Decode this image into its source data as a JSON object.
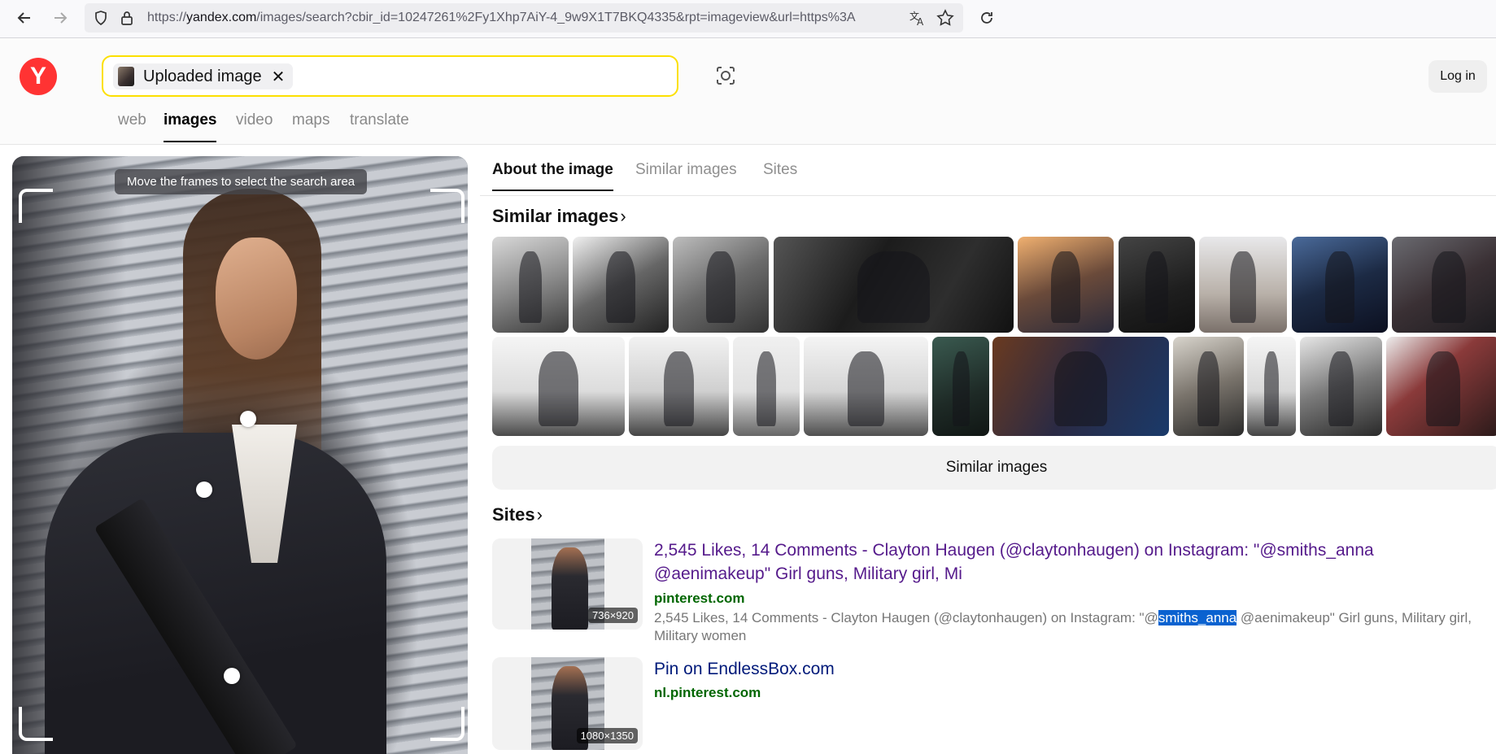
{
  "browser": {
    "url_prefix": "https://",
    "url_domain": "yandex.com",
    "url_rest": "/images/search?cbir_id=10247261%2Fy1Xhp7AiY-4_9w9X1T7BKQ4335&rpt=imageview&url=https%3A"
  },
  "header": {
    "logo_letter": "Y",
    "chip_label": "Uploaded image",
    "chip_close": "✕",
    "login_label": "Log in",
    "services": [
      "web",
      "images",
      "video",
      "maps",
      "translate"
    ]
  },
  "left_panel": {
    "hint": "Move the frames to select the search area"
  },
  "right": {
    "tabs": [
      "About the image",
      "Similar images",
      "Sites"
    ],
    "similar_title": "Similar images",
    "similar_button": "Similar images",
    "sites_title": "Sites",
    "chevron": "›",
    "results": [
      {
        "title": "2,545 Likes, 14 Comments - Clayton Haugen (@claytonhaugen) on Instagram: \"@smiths_anna @aenimakeup\" Girl guns, Military girl, Mi",
        "host": "pinterest.com",
        "desc_before": "2,545 Likes, 14 Comments - Clayton Haugen (@claytonhaugen) on Instagram: \"@",
        "desc_highlight": "smiths_anna",
        "desc_after": " @aenimakeup\" Girl guns, Military girl, Military women",
        "dims": "736×920"
      },
      {
        "title": "Pin on EndlessBox.com",
        "host": "nl.pinterest.com",
        "dims": "1080×1350"
      }
    ]
  },
  "colors": {
    "accent_yellow": "#fce000",
    "logo_red": "#ff3333",
    "visited_link": "#551a8b",
    "host_green": "#006600",
    "highlight": "#0a62d0"
  }
}
